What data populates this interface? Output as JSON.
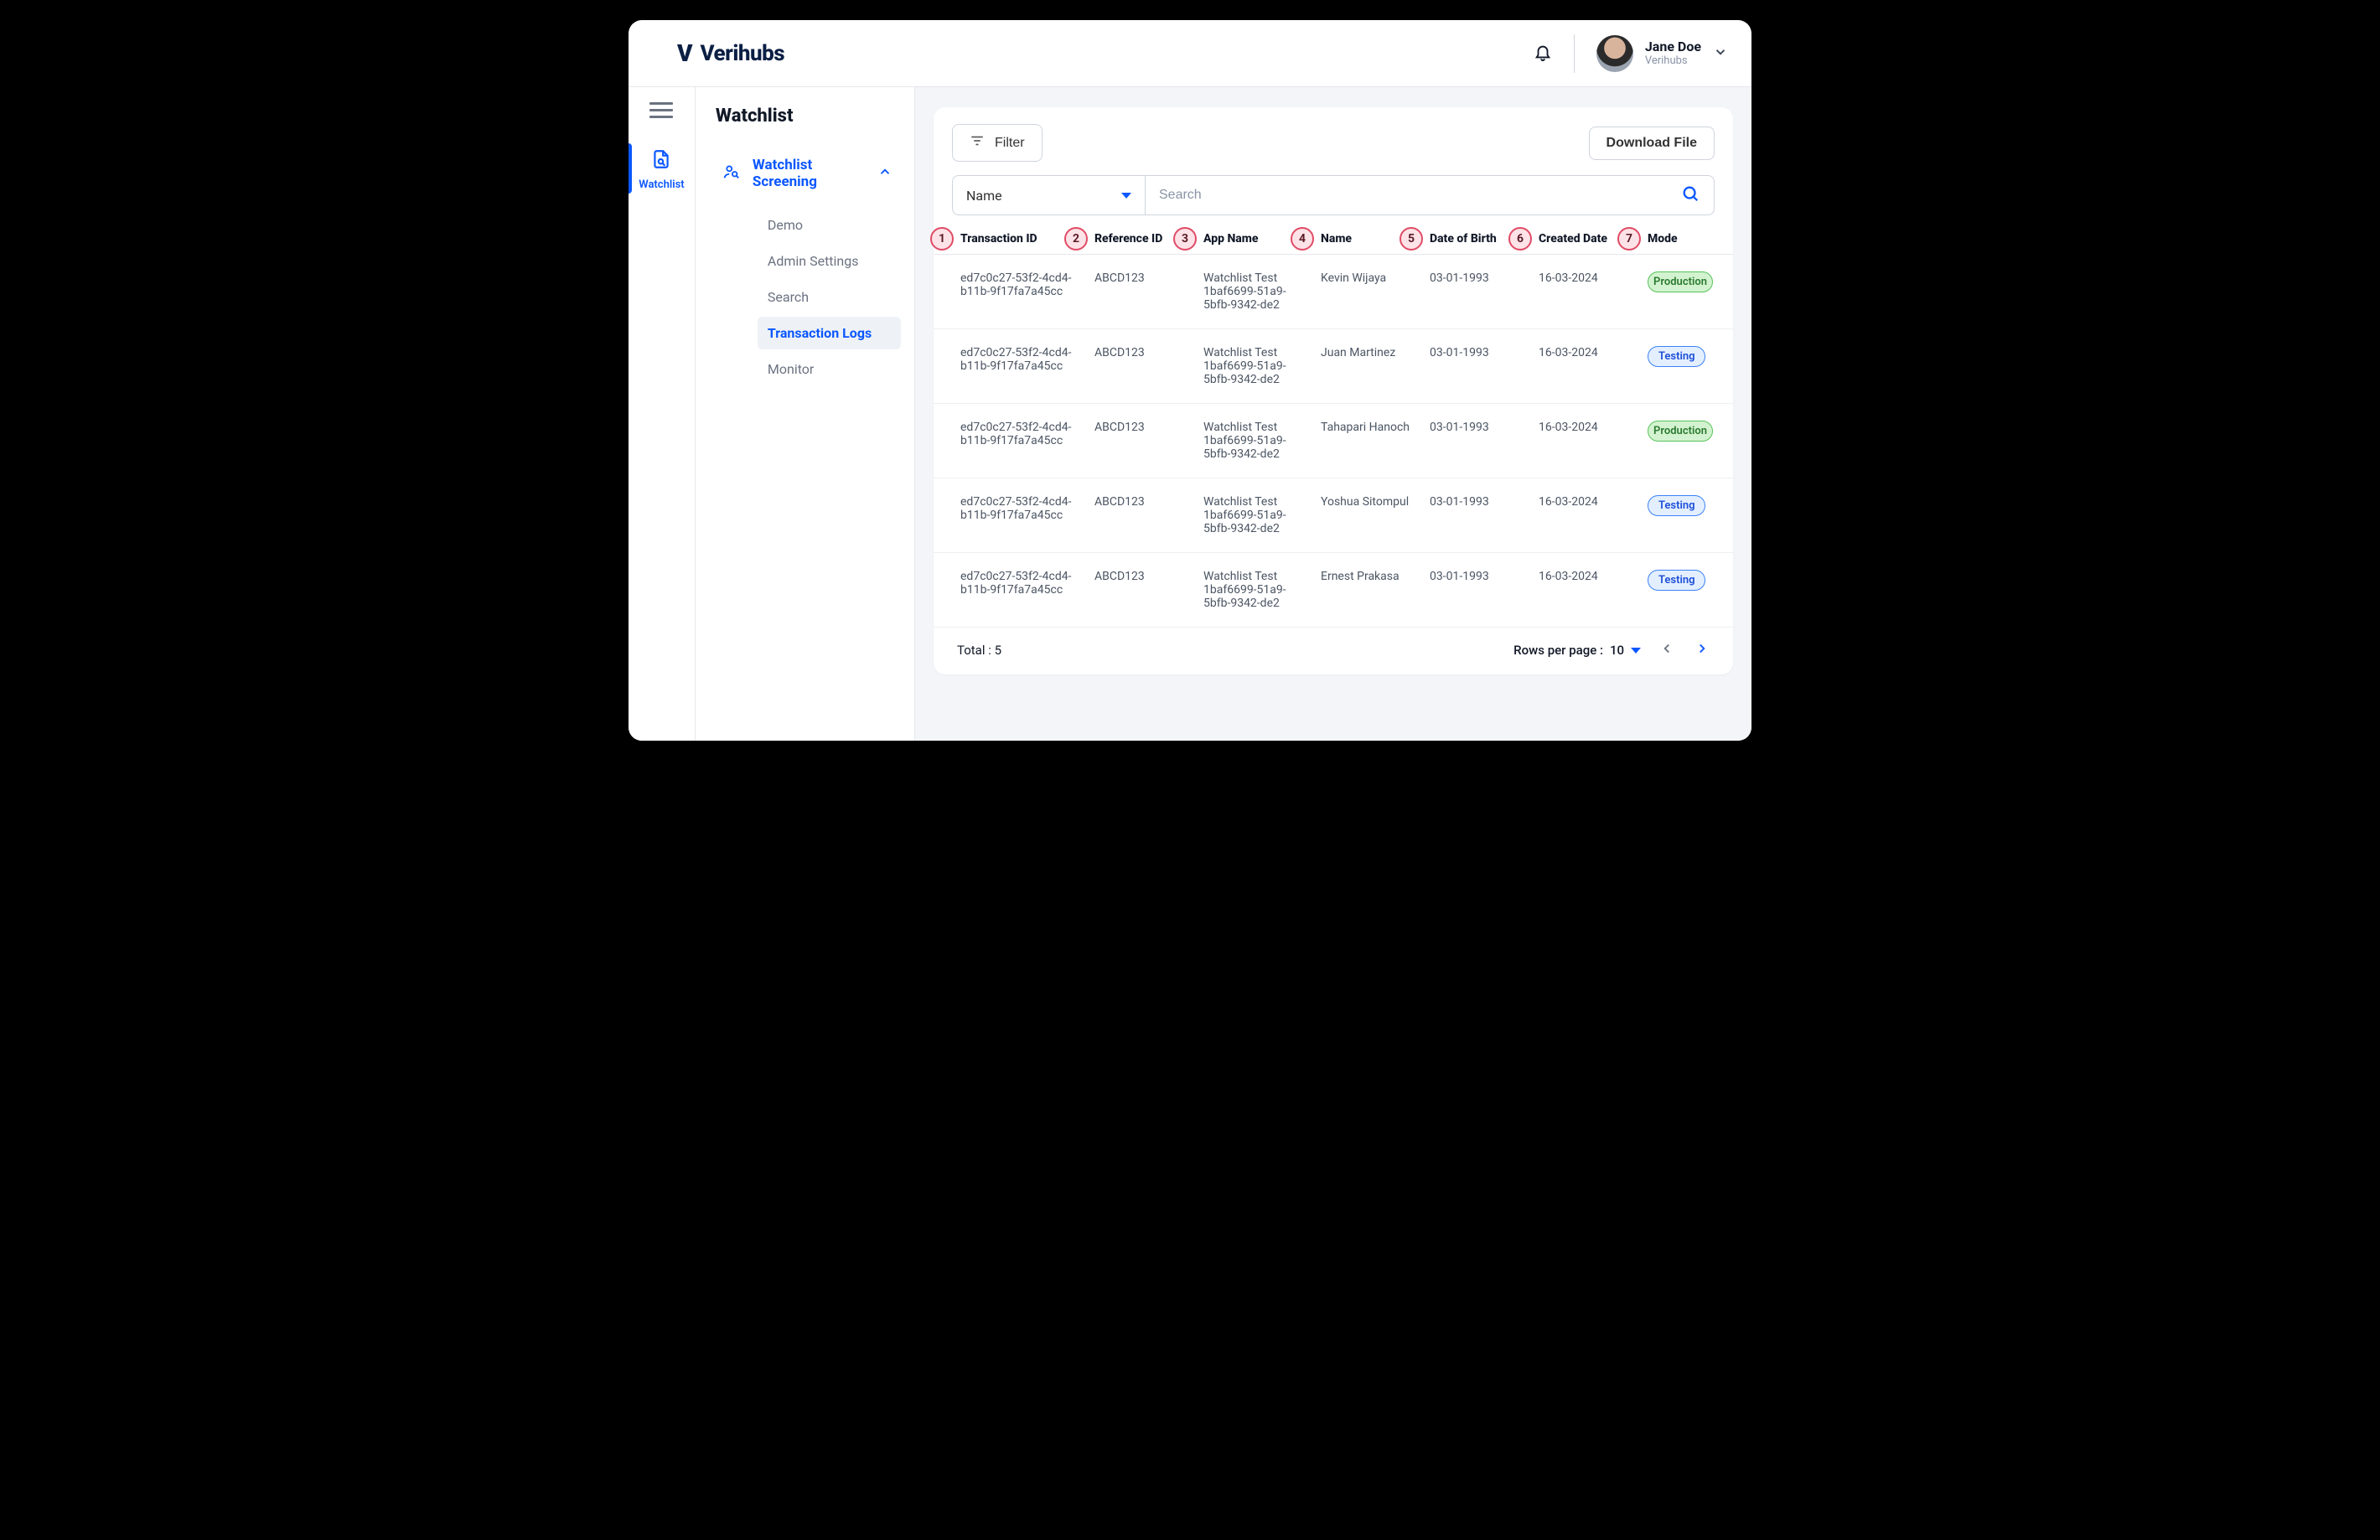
{
  "brand": {
    "mark": "V",
    "name": "Verihubs"
  },
  "user": {
    "name": "Jane Doe",
    "org": "Verihubs"
  },
  "rail": {
    "active_label": "Watchlist"
  },
  "sidebar": {
    "title": "Watchlist",
    "section_label": "Watchlist Screening",
    "items": [
      "Demo",
      "Admin Settings",
      "Search",
      "Transaction Logs",
      "Monitor"
    ],
    "active_index": 3
  },
  "toolbar": {
    "filter_label": "Filter",
    "download_label": "Download File"
  },
  "search": {
    "select_label": "Name",
    "placeholder": "Search"
  },
  "columns": [
    {
      "num": "1",
      "label": "Transaction ID"
    },
    {
      "num": "2",
      "label": "Reference ID"
    },
    {
      "num": "3",
      "label": "App Name"
    },
    {
      "num": "4",
      "label": "Name"
    },
    {
      "num": "5",
      "label": "Date of Birth"
    },
    {
      "num": "6",
      "label": "Created Date"
    },
    {
      "num": "7",
      "label": "Mode"
    }
  ],
  "rows": [
    {
      "txn": "ed7c0c27-53f2-4cd4-b11b-9f17fa7a45cc",
      "ref": "ABCD123",
      "app": "Watchlist Test 1baf6699-51a9-5bfb-9342-de2",
      "name": "Kevin Wijaya",
      "dob": "03-01-1993",
      "created": "16-03-2024",
      "mode": "Production"
    },
    {
      "txn": "ed7c0c27-53f2-4cd4-b11b-9f17fa7a45cc",
      "ref": "ABCD123",
      "app": "Watchlist Test 1baf6699-51a9-5bfb-9342-de2",
      "name": "Juan Martinez",
      "dob": "03-01-1993",
      "created": "16-03-2024",
      "mode": "Testing"
    },
    {
      "txn": "ed7c0c27-53f2-4cd4-b11b-9f17fa7a45cc",
      "ref": "ABCD123",
      "app": "Watchlist Test 1baf6699-51a9-5bfb-9342-de2",
      "name": "Tahapari Hanoch",
      "dob": "03-01-1993",
      "created": "16-03-2024",
      "mode": "Production"
    },
    {
      "txn": "ed7c0c27-53f2-4cd4-b11b-9f17fa7a45cc",
      "ref": "ABCD123",
      "app": "Watchlist Test 1baf6699-51a9-5bfb-9342-de2",
      "name": "Yoshua Sitompul",
      "dob": "03-01-1993",
      "created": "16-03-2024",
      "mode": "Testing"
    },
    {
      "txn": "ed7c0c27-53f2-4cd4-b11b-9f17fa7a45cc",
      "ref": "ABCD123",
      "app": "Watchlist Test 1baf6699-51a9-5bfb-9342-de2",
      "name": "Ernest Prakasa",
      "dob": "03-01-1993",
      "created": "16-03-2024",
      "mode": "Testing"
    }
  ],
  "footer": {
    "total_label": "Total : 5",
    "rpp_label": "Rows per page :",
    "rpp_value": "10"
  }
}
